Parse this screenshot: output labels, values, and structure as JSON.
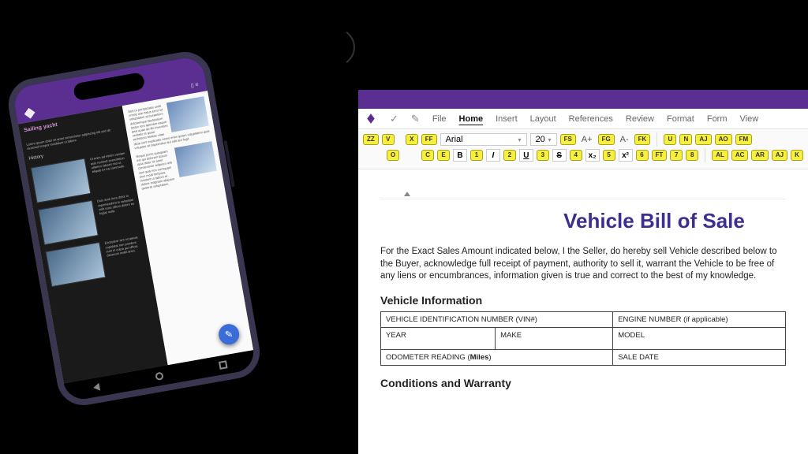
{
  "phone": {
    "article_title": "Sailing yacht",
    "section": "History",
    "fab_glyph": "✎"
  },
  "desktop": {
    "menu": {
      "file": "File",
      "home": "Home",
      "insert": "Insert",
      "layout": "Layout",
      "references": "References",
      "review": "Review",
      "format": "Format",
      "form": "Form",
      "view": "View"
    },
    "toolbar": {
      "font_name": "Arial",
      "font_size": "20",
      "row1": {
        "zz": "ZZ",
        "v": "V",
        "x": "X",
        "ff": "FF",
        "fs": "FS",
        "fg": "FG",
        "fk": "FK",
        "ap": "A+",
        "am": "A-",
        "u": "U",
        "n": "N",
        "aj": "AJ",
        "ao": "AO",
        "fm": "FM"
      },
      "row2": {
        "o": "O",
        "c": "C",
        "e": "E",
        "b": "B",
        "i1": "1",
        "i2": "2",
        "i3": "3",
        "i4": "4",
        "i5": "5",
        "i6": "6",
        "ft": "FT",
        "i7": "7",
        "i8": "8",
        "al": "AL",
        "ac": "AC",
        "ar": "AR",
        "aj2": "AJ",
        "k": "K"
      }
    },
    "doc": {
      "title": "Vehicle Bill of Sale",
      "intro": "For the Exact Sales Amount indicated below, I the Seller, do hereby sell Vehicle described below to the Buyer, acknowledge full receipt of payment, authority to sell it, warrant the Vehicle to be free of any liens or encumbrances, information given is true and correct to the best of my knowledge.",
      "section_vehicle": "Vehicle Information",
      "cells": {
        "vin": "VEHICLE IDENTIFICATION NUMBER (VIN#)",
        "engine": "ENGINE NUMBER (if applicable)",
        "year": "YEAR",
        "make": "MAKE",
        "model": "MODEL",
        "odo_a": "ODOMETER READING (",
        "odo_b": "Miles",
        "odo_c": ")",
        "sale_date": "SALE DATE"
      },
      "section_conditions": "Conditions and Warranty"
    }
  }
}
